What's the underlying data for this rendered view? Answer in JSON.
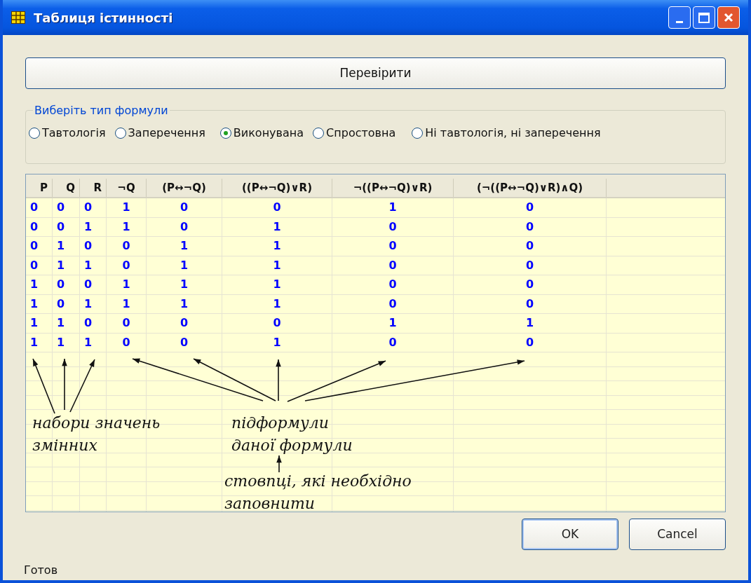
{
  "window": {
    "title": "Таблиця істинності"
  },
  "check_button": "Перевірити",
  "formula_type": {
    "legend": "Виберіть тип формули",
    "options": [
      {
        "label": "Тавтологія",
        "selected": false
      },
      {
        "label": "Заперечення",
        "selected": false
      },
      {
        "label": "Виконувана",
        "selected": true
      },
      {
        "label": "Спростовна",
        "selected": false
      },
      {
        "label": "Ні тавтологія, ні заперечення",
        "selected": false
      }
    ]
  },
  "table": {
    "columns": [
      "P",
      "Q",
      "R",
      "¬Q",
      "(P↔¬Q)",
      "((P↔¬Q)∨R)",
      "¬((P↔¬Q)∨R)",
      "(¬((P↔¬Q)∨R)∧Q)"
    ],
    "rows": [
      [
        "0",
        "0",
        "0",
        "1",
        "0",
        "0",
        "1",
        "0"
      ],
      [
        "0",
        "0",
        "1",
        "1",
        "0",
        "1",
        "0",
        "0"
      ],
      [
        "0",
        "1",
        "0",
        "0",
        "1",
        "1",
        "0",
        "0"
      ],
      [
        "0",
        "1",
        "1",
        "0",
        "1",
        "1",
        "0",
        "0"
      ],
      [
        "1",
        "0",
        "0",
        "1",
        "1",
        "1",
        "0",
        "0"
      ],
      [
        "1",
        "0",
        "1",
        "1",
        "1",
        "1",
        "0",
        "0"
      ],
      [
        "1",
        "1",
        "0",
        "0",
        "0",
        "0",
        "1",
        "1"
      ],
      [
        "1",
        "1",
        "1",
        "0",
        "0",
        "1",
        "0",
        "0"
      ]
    ]
  },
  "annotations": [
    {
      "lines": [
        "набори значень",
        "змінних"
      ]
    },
    {
      "lines": [
        "підформули",
        "даної формули"
      ]
    },
    {
      "lines": [
        "стовпці, які необхідно",
        "заповнити"
      ]
    }
  ],
  "buttons": [
    "OK",
    "Cancel"
  ],
  "status_bar": "Готов"
}
